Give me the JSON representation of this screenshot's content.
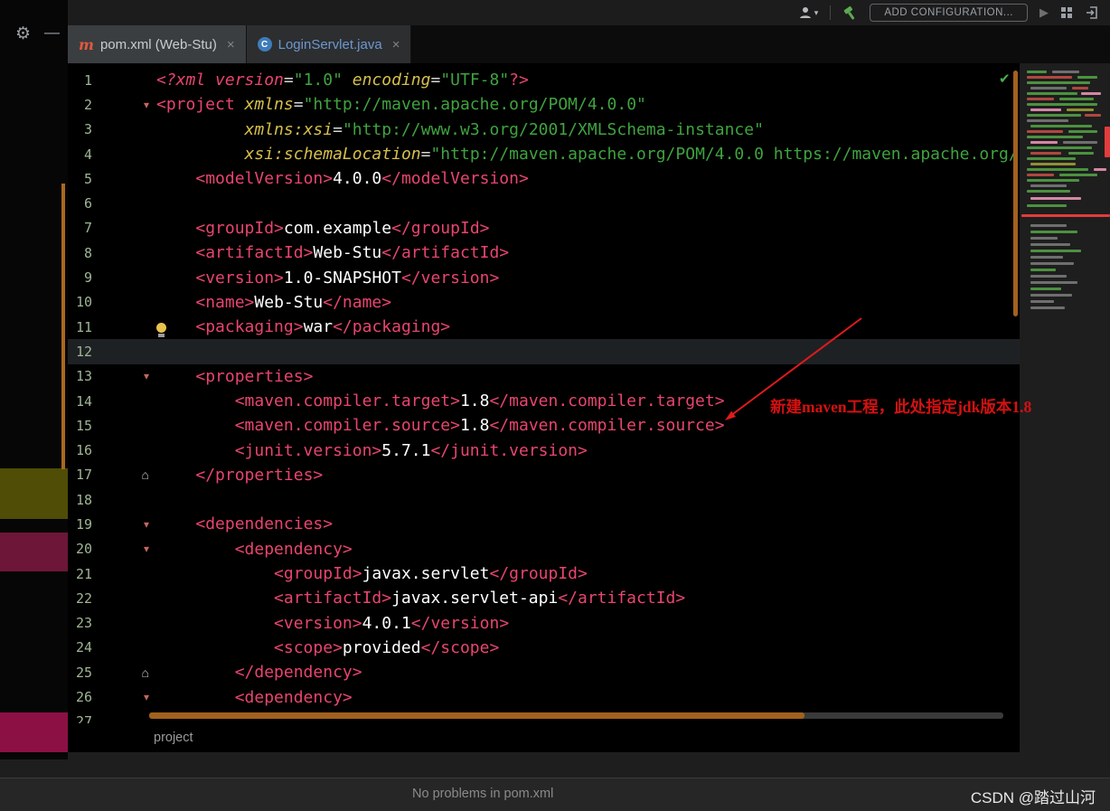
{
  "topbar": {
    "add_configuration": "ADD CONFIGURATION..."
  },
  "tabs": [
    {
      "label": "pom.xml (Web-Stu)",
      "icon": "maven",
      "active": true
    },
    {
      "label": "LoginServlet.java",
      "icon": "class",
      "active": false
    }
  ],
  "editor": {
    "current_line": 12,
    "checkmark": "✔",
    "lines": [
      {
        "n": 1,
        "toks": [
          [
            "tagi",
            "<?xml version"
          ],
          [
            "eq",
            "="
          ],
          [
            "str",
            "\"1.0\""
          ],
          [
            "pl",
            " "
          ],
          [
            "attr",
            "encoding"
          ],
          [
            "eq",
            "="
          ],
          [
            "str",
            "\"UTF-8\""
          ],
          [
            "tag",
            "?>"
          ]
        ]
      },
      {
        "n": 2,
        "fold": "s",
        "toks": [
          [
            "tag",
            "<project "
          ],
          [
            "attr",
            "xmlns"
          ],
          [
            "eq",
            "="
          ],
          [
            "str",
            "\"http://maven.apache.org/POM/4.0.0\""
          ]
        ]
      },
      {
        "n": 3,
        "toks": [
          [
            "pl",
            "         "
          ],
          [
            "attr",
            "xmlns:xsi"
          ],
          [
            "eq",
            "="
          ],
          [
            "str",
            "\"http://www.w3.org/2001/XMLSchema-instance\""
          ]
        ]
      },
      {
        "n": 4,
        "toks": [
          [
            "pl",
            "         "
          ],
          [
            "attr",
            "xsi:schemaLocation"
          ],
          [
            "eq",
            "="
          ],
          [
            "str",
            "\"http://maven.apache.org/POM/4.0.0 https://maven.apache.org/"
          ]
        ]
      },
      {
        "n": 5,
        "toks": [
          [
            "pl",
            "    "
          ],
          [
            "tag",
            "<modelVersion>"
          ],
          [
            "pl",
            "4.0.0"
          ],
          [
            "tag",
            "</modelVersion>"
          ]
        ]
      },
      {
        "n": 6,
        "toks": []
      },
      {
        "n": 7,
        "toks": [
          [
            "pl",
            "    "
          ],
          [
            "tag",
            "<groupId>"
          ],
          [
            "pl",
            "com.example"
          ],
          [
            "tag",
            "</groupId>"
          ]
        ]
      },
      {
        "n": 8,
        "toks": [
          [
            "pl",
            "    "
          ],
          [
            "tag",
            "<artifactId>"
          ],
          [
            "pl",
            "Web-Stu"
          ],
          [
            "tag",
            "</artifactId>"
          ]
        ]
      },
      {
        "n": 9,
        "toks": [
          [
            "pl",
            "    "
          ],
          [
            "tag",
            "<version>"
          ],
          [
            "pl",
            "1.0-SNAPSHOT"
          ],
          [
            "tag",
            "</version>"
          ]
        ]
      },
      {
        "n": 10,
        "toks": [
          [
            "pl",
            "    "
          ],
          [
            "tag",
            "<name>"
          ],
          [
            "pl",
            "Web-Stu"
          ],
          [
            "tag",
            "</name>"
          ]
        ]
      },
      {
        "n": 11,
        "toks": [
          [
            "pl",
            "    "
          ],
          [
            "tag",
            "<packaging>"
          ],
          [
            "pl",
            "war"
          ],
          [
            "tag",
            "</packaging>"
          ]
        ]
      },
      {
        "n": 12,
        "toks": []
      },
      {
        "n": 13,
        "fold": "s",
        "toks": [
          [
            "pl",
            "    "
          ],
          [
            "tag",
            "<properties>"
          ]
        ]
      },
      {
        "n": 14,
        "toks": [
          [
            "pl",
            "        "
          ],
          [
            "tag",
            "<maven.compiler.target>"
          ],
          [
            "pl",
            "1.8"
          ],
          [
            "tag",
            "</maven.compiler.target>"
          ]
        ]
      },
      {
        "n": 15,
        "toks": [
          [
            "pl",
            "        "
          ],
          [
            "tag",
            "<maven.compiler.source>"
          ],
          [
            "pl",
            "1.8"
          ],
          [
            "tag",
            "</maven.compiler.source>"
          ]
        ]
      },
      {
        "n": 16,
        "toks": [
          [
            "pl",
            "        "
          ],
          [
            "tag",
            "<junit.version>"
          ],
          [
            "pl",
            "5.7.1"
          ],
          [
            "tag",
            "</junit.version>"
          ]
        ]
      },
      {
        "n": 17,
        "fold": "e",
        "toks": [
          [
            "pl",
            "    "
          ],
          [
            "tag",
            "</properties>"
          ]
        ]
      },
      {
        "n": 18,
        "toks": []
      },
      {
        "n": 19,
        "fold": "s",
        "toks": [
          [
            "pl",
            "    "
          ],
          [
            "tag",
            "<dependencies>"
          ]
        ]
      },
      {
        "n": 20,
        "fold": "s",
        "toks": [
          [
            "pl",
            "        "
          ],
          [
            "tag",
            "<dependency>"
          ]
        ]
      },
      {
        "n": 21,
        "toks": [
          [
            "pl",
            "            "
          ],
          [
            "tag",
            "<groupId>"
          ],
          [
            "pl",
            "javax.servlet"
          ],
          [
            "tag",
            "</groupId>"
          ]
        ]
      },
      {
        "n": 22,
        "toks": [
          [
            "pl",
            "            "
          ],
          [
            "tag",
            "<artifactId>"
          ],
          [
            "pl",
            "javax.servlet-api"
          ],
          [
            "tag",
            "</artifactId>"
          ]
        ]
      },
      {
        "n": 23,
        "toks": [
          [
            "pl",
            "            "
          ],
          [
            "tag",
            "<version>"
          ],
          [
            "pl",
            "4.0.1"
          ],
          [
            "tag",
            "</version>"
          ]
        ]
      },
      {
        "n": 24,
        "toks": [
          [
            "pl",
            "            "
          ],
          [
            "tag",
            "<scope>"
          ],
          [
            "pl",
            "provided"
          ],
          [
            "tag",
            "</scope>"
          ]
        ]
      },
      {
        "n": 25,
        "fold": "e",
        "toks": [
          [
            "pl",
            "        "
          ],
          [
            "tag",
            "</dependency>"
          ]
        ]
      },
      {
        "n": 26,
        "fold": "s",
        "toks": [
          [
            "pl",
            "        "
          ],
          [
            "tag",
            "<dependency>"
          ]
        ]
      },
      {
        "n": 27,
        "toks": []
      }
    ]
  },
  "annotation": {
    "text": "新建maven工程，此处指定jdk版本1.8"
  },
  "breadcrumb": {
    "item": "project"
  },
  "statusbar": {
    "message": "No problems in pom.xml",
    "watermark": "CSDN @踏过山河"
  },
  "colors": {
    "editor_bg": "#000000",
    "tag": "#e8456e",
    "attribute": "#d7bf4c",
    "string": "#3fa33f",
    "plain_text": "#ffffff",
    "line_number": "#9fb694",
    "scrollbar_orange": "#a2611e",
    "annotation_red": "#d41111",
    "check_green": "#4db04a",
    "maven_icon_orange": "#e2593d",
    "class_icon_blue": "#3f7cba"
  },
  "minimap": {
    "bars": [
      [
        8,
        8,
        22,
        3,
        "g"
      ],
      [
        8,
        36,
        30,
        3,
        "gy"
      ],
      [
        14,
        8,
        50,
        3,
        "r"
      ],
      [
        14,
        64,
        22,
        3,
        "g"
      ],
      [
        20,
        8,
        70,
        3,
        "g"
      ],
      [
        26,
        12,
        40,
        3,
        "gy"
      ],
      [
        26,
        58,
        18,
        3,
        "r"
      ],
      [
        32,
        8,
        56,
        3,
        "g"
      ],
      [
        32,
        68,
        22,
        3,
        "p"
      ],
      [
        38,
        8,
        30,
        3,
        "r"
      ],
      [
        38,
        44,
        38,
        3,
        "g"
      ],
      [
        44,
        8,
        78,
        3,
        "g"
      ],
      [
        50,
        12,
        34,
        3,
        "p"
      ],
      [
        50,
        52,
        30,
        3,
        "o"
      ],
      [
        56,
        8,
        60,
        3,
        "g"
      ],
      [
        56,
        72,
        18,
        3,
        "r"
      ],
      [
        62,
        8,
        46,
        3,
        "gy"
      ],
      [
        68,
        12,
        68,
        3,
        "g"
      ],
      [
        70,
        94,
        6,
        34,
        "rd"
      ],
      [
        74,
        8,
        40,
        3,
        "r"
      ],
      [
        74,
        54,
        32,
        3,
        "g"
      ],
      [
        80,
        8,
        62,
        3,
        "g"
      ],
      [
        86,
        12,
        30,
        3,
        "p"
      ],
      [
        86,
        48,
        38,
        3,
        "gy"
      ],
      [
        92,
        8,
        72,
        3,
        "g"
      ],
      [
        98,
        12,
        34,
        3,
        "r"
      ],
      [
        98,
        54,
        28,
        3,
        "g"
      ],
      [
        104,
        8,
        54,
        3,
        "g"
      ],
      [
        110,
        12,
        50,
        3,
        "o"
      ],
      [
        116,
        8,
        68,
        3,
        "g"
      ],
      [
        116,
        82,
        14,
        3,
        "p"
      ],
      [
        122,
        8,
        30,
        3,
        "r"
      ],
      [
        122,
        44,
        42,
        3,
        "g"
      ],
      [
        128,
        8,
        58,
        3,
        "g"
      ],
      [
        134,
        12,
        40,
        3,
        "gy"
      ],
      [
        140,
        8,
        48,
        3,
        "g"
      ],
      [
        148,
        12,
        56,
        3,
        "p"
      ],
      [
        156,
        8,
        44,
        3,
        "g"
      ],
      [
        167,
        2,
        98,
        3,
        "rd"
      ],
      [
        178,
        12,
        40,
        3,
        "gy"
      ],
      [
        185,
        12,
        52,
        3,
        "g"
      ],
      [
        192,
        12,
        30,
        3,
        "gy"
      ],
      [
        199,
        12,
        44,
        3,
        "gy"
      ],
      [
        206,
        12,
        56,
        3,
        "g"
      ],
      [
        213,
        12,
        36,
        3,
        "gy"
      ],
      [
        220,
        12,
        48,
        3,
        "gy"
      ],
      [
        227,
        12,
        28,
        3,
        "g"
      ],
      [
        234,
        12,
        40,
        3,
        "gy"
      ],
      [
        241,
        12,
        52,
        3,
        "gy"
      ],
      [
        248,
        12,
        34,
        3,
        "g"
      ],
      [
        255,
        12,
        46,
        3,
        "gy"
      ],
      [
        262,
        12,
        26,
        3,
        "gy"
      ],
      [
        269,
        12,
        38,
        3,
        "gy"
      ]
    ]
  }
}
